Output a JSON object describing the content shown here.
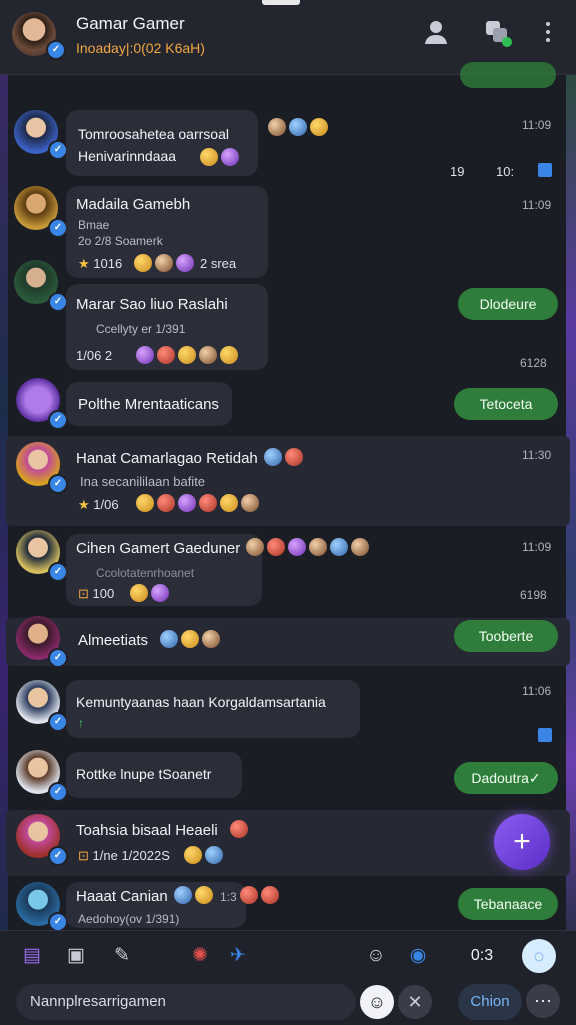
{
  "header": {
    "title": "Gamar Gamer",
    "subtitle": "Inoaday|:0(02 K6aH)",
    "verified_mark": "✓"
  },
  "chats": [
    {
      "name": "Tomroosahetea oarrsoal",
      "preview": "Henivarinndaaa",
      "time": "11:09",
      "meta": "19",
      "meta2": "10:"
    },
    {
      "name": "Madaila Gamebh",
      "sub": "Bmae",
      "sub2": "2o 2/8 Soamerk",
      "meta": "1016",
      "meta2": "2 srea",
      "time": "11:09"
    },
    {
      "name": "Marar Sao liuo Raslahi",
      "sub": "Ccellyty er 1/391",
      "meta": "1/06 2",
      "time": "6128",
      "reply": "Dlodeure"
    },
    {
      "name": "Polthe Mrentaaticans",
      "reply": "Tetoceta"
    },
    {
      "name": "Hanat Camarlagao Retidah",
      "sub": "Ina secanililaan bafite",
      "meta": "1/06",
      "time": "11:30"
    },
    {
      "name": "Cihen Gamert Gaeduner",
      "sub": "Ccolotatenrhoanet",
      "meta": "100",
      "time": "11:09",
      "time2": "6198"
    },
    {
      "name": "Almeetiats",
      "reply": "Tooberte"
    },
    {
      "name": "Kemuntyaanas haan Korgaldamsartania",
      "sub": "↑",
      "time": "11:06"
    },
    {
      "name": "Rottke lnupe tSoanetr",
      "reply": "Dadoutra✓"
    },
    {
      "name": "Toahsia bisaal Heaeli",
      "meta": "1/ne 1/2022S"
    },
    {
      "name": "Haaat Canian",
      "sub": "Aedohoy(ov 1/391)",
      "time": "1:3",
      "reply": "Tebanaace"
    }
  ],
  "composer": {
    "placeholder": "Nannplresarrigamen",
    "count": "0:3",
    "chat_button": "Chion",
    "fab": "+"
  },
  "colors": {
    "accent": "#7a4fe0",
    "green": "#2e7d3a",
    "orange": "#f0a640"
  }
}
